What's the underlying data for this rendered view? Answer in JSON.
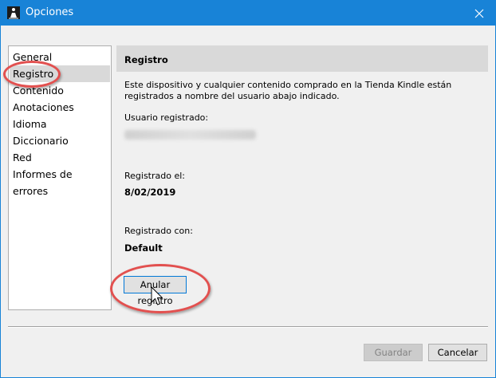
{
  "window": {
    "title": "Opciones",
    "accent": "#1883d7"
  },
  "titlebar": {
    "icon": "kindle-reader-icon",
    "close_glyph": "✕"
  },
  "sidebar": {
    "selected": 1,
    "items": [
      {
        "label": "General"
      },
      {
        "label": "Registro"
      },
      {
        "label": "Contenido"
      },
      {
        "label": "Anotaciones"
      },
      {
        "label": "Idioma"
      },
      {
        "label": "Diccionario"
      },
      {
        "label": "Red"
      },
      {
        "label": "Informes de errores"
      }
    ]
  },
  "panel": {
    "title": "Registro",
    "description": "Este dispositivo y cualquier contenido comprado en la Tienda Kindle están registrados a nombre del usuario abajo indicado.",
    "user_label": "Usuario registrado:",
    "date_label": "Registrado el:",
    "date_value": "8/02/2019",
    "device_label": "Registrado con:",
    "device_value": "Default",
    "deregister_label": "Anular registro"
  },
  "footer": {
    "save_label": "Guardar",
    "cancel_label": "Cancelar"
  },
  "annotation_color": "#e2504f"
}
